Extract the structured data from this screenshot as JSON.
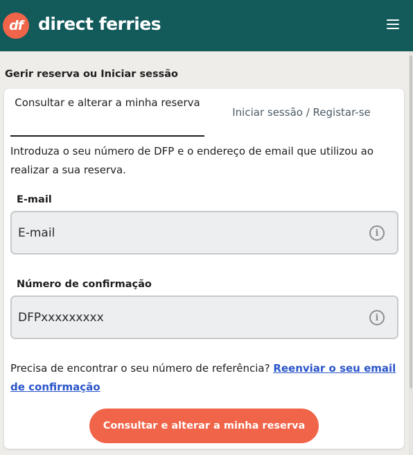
{
  "header": {
    "logo_text": "df",
    "brand": "direct ferries",
    "brand_color": "#135a5b",
    "accent_color": "#f06449",
    "menu_icon": "hamburger-menu-icon"
  },
  "page": {
    "section_title": "Gerir reserva ou Iniciar sessão"
  },
  "tabs": [
    {
      "label": "Consultar e alterar a minha reserva",
      "active": true
    },
    {
      "label": "Iniciar sessão / Registar-se",
      "active": false
    }
  ],
  "form": {
    "intro": "Introduza o seu número de DFP e o endereço de email que utilizou ao realizar a sua reserva.",
    "email_label": "E-mail",
    "email_placeholder": "E-mail",
    "email_value": "",
    "confirmation_label": "Número de confirmação",
    "confirmation_placeholder": "DFPxxxxxxxxx",
    "confirmation_value": "",
    "info_icon": "info-icon",
    "help_text": "Precisa de encontrar o seu número de referência?",
    "help_link": "Reenviar o seu email de confirmação",
    "submit_label": "Consultar e alterar a minha reserva"
  }
}
